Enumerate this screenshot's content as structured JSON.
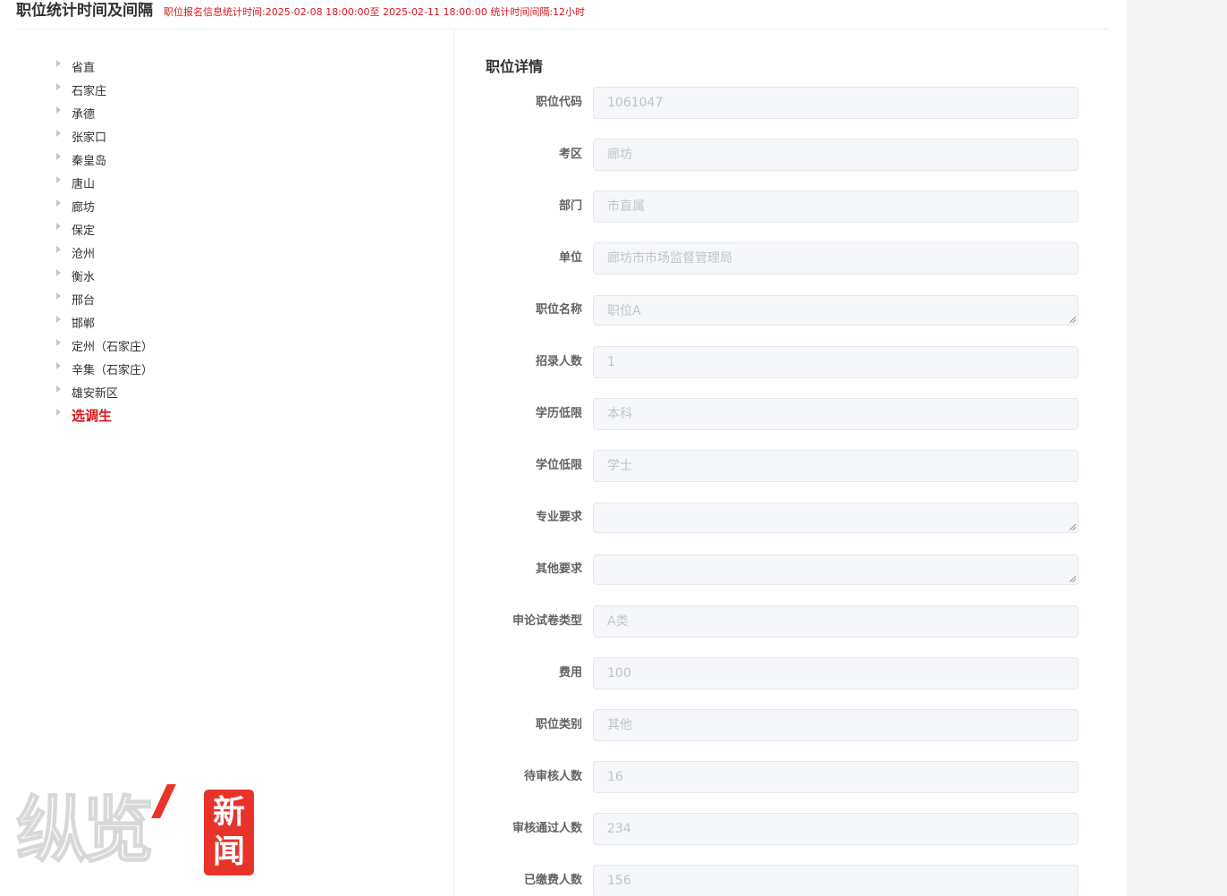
{
  "header": {
    "title": "职位统计时间及间隔",
    "stat": "职位报名信息统计时间:2025-02-08 18:00:00至 2025-02-11 18:00:00 统计时间间隔:12小时"
  },
  "tree": {
    "items": [
      {
        "label": "省直"
      },
      {
        "label": "石家庄"
      },
      {
        "label": "承德"
      },
      {
        "label": "张家口"
      },
      {
        "label": "秦皇岛"
      },
      {
        "label": "唐山"
      },
      {
        "label": "廊坊"
      },
      {
        "label": "保定"
      },
      {
        "label": "沧州"
      },
      {
        "label": "衡水"
      },
      {
        "label": "邢台"
      },
      {
        "label": "邯郸"
      },
      {
        "label": "定州（石家庄）"
      },
      {
        "label": "辛集（石家庄）"
      },
      {
        "label": "雄安新区"
      },
      {
        "label": "选调生"
      }
    ],
    "active_index": 15,
    "active_color": "#d9141b"
  },
  "detail": {
    "title": "职位详情",
    "fields": [
      {
        "label": "职位代码",
        "value": "1061047",
        "type": "input"
      },
      {
        "label": "考区",
        "value": "廊坊",
        "type": "input"
      },
      {
        "label": "部门",
        "value": "市直属",
        "type": "input"
      },
      {
        "label": "单位",
        "value": "廊坊市市场监督管理局",
        "type": "input"
      },
      {
        "label": "职位名称",
        "value": "职位A",
        "type": "textarea"
      },
      {
        "label": "招录人数",
        "value": "1",
        "type": "input"
      },
      {
        "label": "学历低限",
        "value": "本科",
        "type": "input"
      },
      {
        "label": "学位低限",
        "value": "学士",
        "type": "input"
      },
      {
        "label": "专业要求",
        "value": "",
        "type": "textarea"
      },
      {
        "label": "其他要求",
        "value": "",
        "type": "textarea"
      },
      {
        "label": "申论试卷类型",
        "value": "A类",
        "type": "input"
      },
      {
        "label": "费用",
        "value": "100",
        "type": "input"
      },
      {
        "label": "职位类别",
        "value": "其他",
        "type": "input"
      },
      {
        "label": "待审核人数",
        "value": "16",
        "type": "input"
      },
      {
        "label": "审核通过人数",
        "value": "234",
        "type": "input"
      },
      {
        "label": "已缴费人数",
        "value": "156",
        "type": "input"
      }
    ]
  },
  "watermark": {
    "logo_text": "纵览",
    "badge_line1": "新",
    "badge_line2": "闻"
  },
  "icons": {
    "tree_caret": "caret-right-icon",
    "resize": "resize-grip-icon"
  },
  "colors": {
    "accent_red": "#d9141b",
    "field_bg": "#f5f7fa",
    "field_border": "#e4e7ed",
    "placeholder_text": "#c0c4cc",
    "watermark_red": "#e8332a"
  }
}
